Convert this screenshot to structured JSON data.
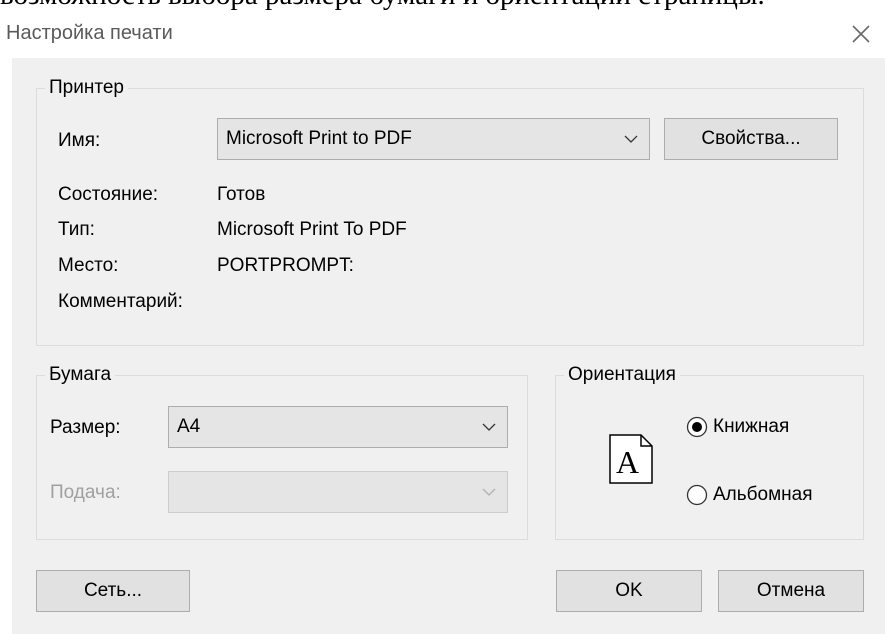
{
  "cut_text": "возможность выбора размера бумаги и ориентации страницы.",
  "window": {
    "title": "Настройка печати"
  },
  "printer": {
    "group_label": "Принтер",
    "name_label": "Имя:",
    "name_value": "Microsoft Print to PDF",
    "properties_button": "Свойства...",
    "status_label": "Состояние:",
    "status_value": "Готов",
    "type_label": "Тип:",
    "type_value": "Microsoft Print To PDF",
    "location_label": "Место:",
    "location_value": "PORTPROMPT:",
    "comment_label": "Комментарий:",
    "comment_value": ""
  },
  "paper": {
    "group_label": "Бумага",
    "size_label": "Размер:",
    "size_value": "A4",
    "source_label": "Подача:",
    "source_value": ""
  },
  "orientation": {
    "group_label": "Ориентация",
    "options": [
      {
        "label": "Книжная",
        "selected": true
      },
      {
        "label": "Альбомная",
        "selected": false
      }
    ],
    "preview_letter": "A"
  },
  "buttons": {
    "network": "Сеть...",
    "ok": "OK",
    "cancel": "Отмена"
  }
}
